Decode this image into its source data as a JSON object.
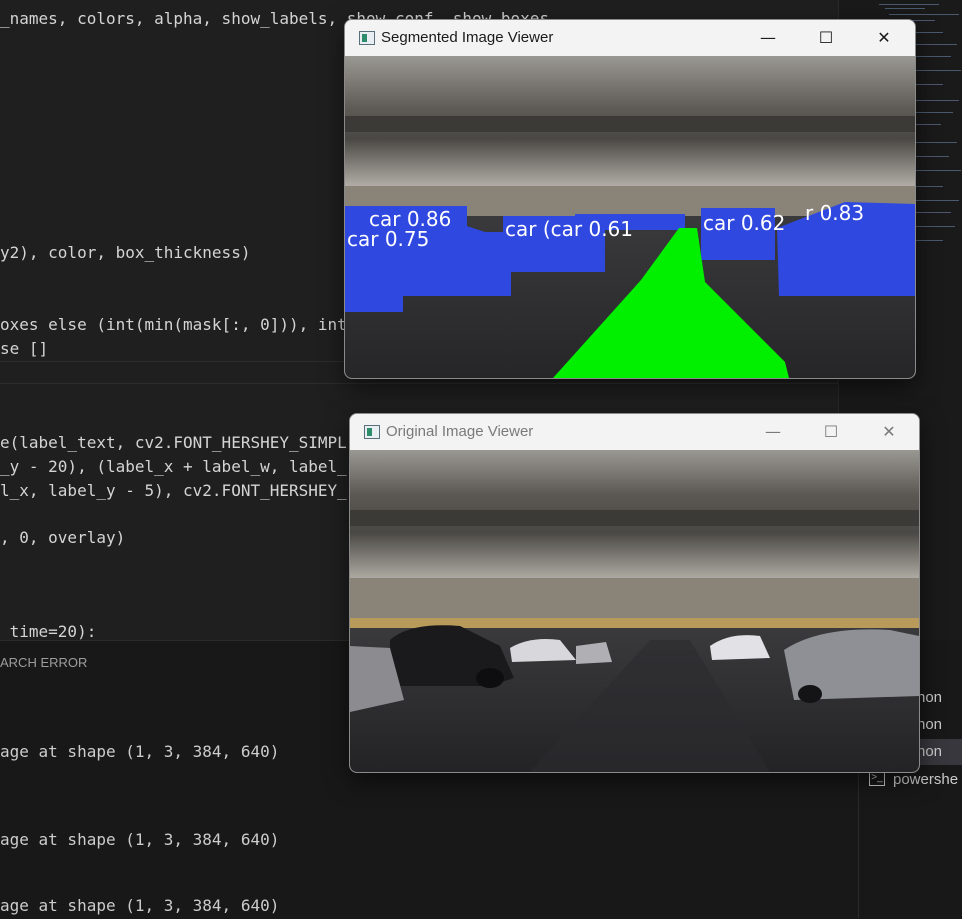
{
  "editor": {
    "lines": [
      {
        "text": "_names, colors, alpha, show_labels, show_conf, show_boxes"
      },
      {
        "text": "y2), color, box_thickness)"
      },
      {
        "text": "oxes else (int(min(mask[:, 0])), int("
      },
      {
        "text": "se []"
      },
      {
        "text": "e(label_text, cv2.FONT_HERSHEY_SIMPL"
      },
      {
        "text": "_y - 20), (label_x + label_w, label_"
      },
      {
        "text": "l_x, label_y - 5), cv2.FONT_HERSHEY_"
      },
      {
        "text": ", 0, overlay)"
      },
      {
        "text": " time=20):"
      }
    ]
  },
  "panel": {
    "tab_label": "ARCH ERROR",
    "terminal_lines": [
      "age at shape (1, 3, 384, 640)",
      "age at shape (1, 3, 384, 640)",
      "age at shape (1, 3, 384, 640)"
    ],
    "terminals": [
      "hon",
      "hon",
      "hon",
      "powershe"
    ]
  },
  "segmented_window": {
    "title": "Segmented Image Viewer",
    "labels": [
      "car 0.86",
      "car 0.75",
      "car (car 0.61",
      "car 0.62",
      "r 0.83"
    ]
  },
  "original_window": {
    "title": "Original Image Viewer"
  },
  "colors": {
    "mask_blue": "#2f48e0",
    "mask_green": "#00f000"
  }
}
